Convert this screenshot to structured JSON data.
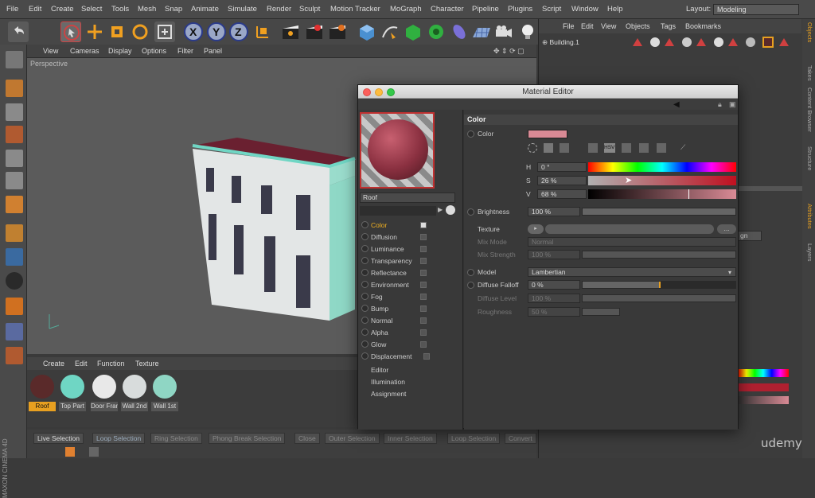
{
  "menubar": {
    "items": [
      "File",
      "Edit",
      "Create",
      "Select",
      "Tools",
      "Mesh",
      "Snap",
      "Animate",
      "Simulate",
      "Render",
      "Sculpt",
      "Motion Tracker",
      "MoGraph",
      "Character",
      "Pipeline",
      "Plugins",
      "Script",
      "Window",
      "Help"
    ],
    "layout_label": "Layout:",
    "layout_value": "Modeling"
  },
  "viewport": {
    "menu": [
      "View",
      "Cameras",
      "Display",
      "Options",
      "Filter",
      "Panel"
    ],
    "label": "Perspective"
  },
  "material_manager": {
    "menu": [
      "Create",
      "Edit",
      "Function",
      "Texture"
    ],
    "materials": [
      {
        "name": "Roof",
        "color": "#5a2a2a",
        "selected": true
      },
      {
        "name": "Top Part",
        "color": "#6fd6c4",
        "selected": false
      },
      {
        "name": "Door Frame",
        "color": "#e8e8e8",
        "selected": false
      },
      {
        "name": "Wall 2nd",
        "color": "#d8dcdc",
        "selected": false
      },
      {
        "name": "Wall 1st",
        "color": "#8fd6c4",
        "selected": false
      }
    ]
  },
  "statusbar": {
    "buttons": [
      "Live Selection",
      "Loop Selection",
      "Ring Selection",
      "Phong Break Selection",
      "Close",
      "Outer Selection",
      "Inner Selection",
      "Loop Selection",
      "Convert"
    ]
  },
  "object_manager": {
    "menu": [
      "File",
      "Edit",
      "View",
      "Objects",
      "Tags",
      "Bookmarks"
    ],
    "object_name": "Building.1"
  },
  "side_tabs": [
    "Objects",
    "Takes",
    "Content Browser",
    "Structure",
    "Attributes",
    "Layers"
  ],
  "material_editor": {
    "title": "Material Editor",
    "material_name": "Roof",
    "channels": [
      {
        "name": "Color",
        "checked": true,
        "active": true
      },
      {
        "name": "Diffusion",
        "checked": false
      },
      {
        "name": "Luminance",
        "checked": false
      },
      {
        "name": "Transparency",
        "checked": false
      },
      {
        "name": "Reflectance",
        "checked": false
      },
      {
        "name": "Environment",
        "checked": false
      },
      {
        "name": "Fog",
        "checked": false
      },
      {
        "name": "Bump",
        "checked": false
      },
      {
        "name": "Normal",
        "checked": false
      },
      {
        "name": "Alpha",
        "checked": false
      },
      {
        "name": "Glow",
        "checked": false
      },
      {
        "name": "Displacement",
        "checked": false
      }
    ],
    "extra_items": [
      "Editor",
      "Illumination",
      "Assignment"
    ],
    "section_title": "Color",
    "color_label": "Color",
    "color_swatch": "#d98a95",
    "h": {
      "label": "H",
      "value": "0 °"
    },
    "s": {
      "label": "S",
      "value": "26 %"
    },
    "v": {
      "label": "V",
      "value": "68 %"
    },
    "brightness": {
      "label": "Brightness",
      "value": "100 %",
      "fraction": 1.0
    },
    "texture_label": "Texture",
    "texture_button": "...",
    "mix_mode": {
      "label": "Mix Mode",
      "value": "Normal"
    },
    "mix_strength": {
      "label": "Mix Strength",
      "value": "100 %"
    },
    "model": {
      "label": "Model",
      "value": "Lambertian"
    },
    "diffuse_falloff": {
      "label": "Diffuse Falloff",
      "value": "0 %",
      "fraction": 0.5
    },
    "diffuse_level": {
      "label": "Diffuse Level",
      "value": "100 %"
    },
    "roughness": {
      "label": "Roughness",
      "value": "50 %",
      "fraction": 0.25
    }
  },
  "attributes": {
    "button_fragment": "gn"
  },
  "watermark": "udemy",
  "brand_vertical": "MAXON CINEMA 4D"
}
